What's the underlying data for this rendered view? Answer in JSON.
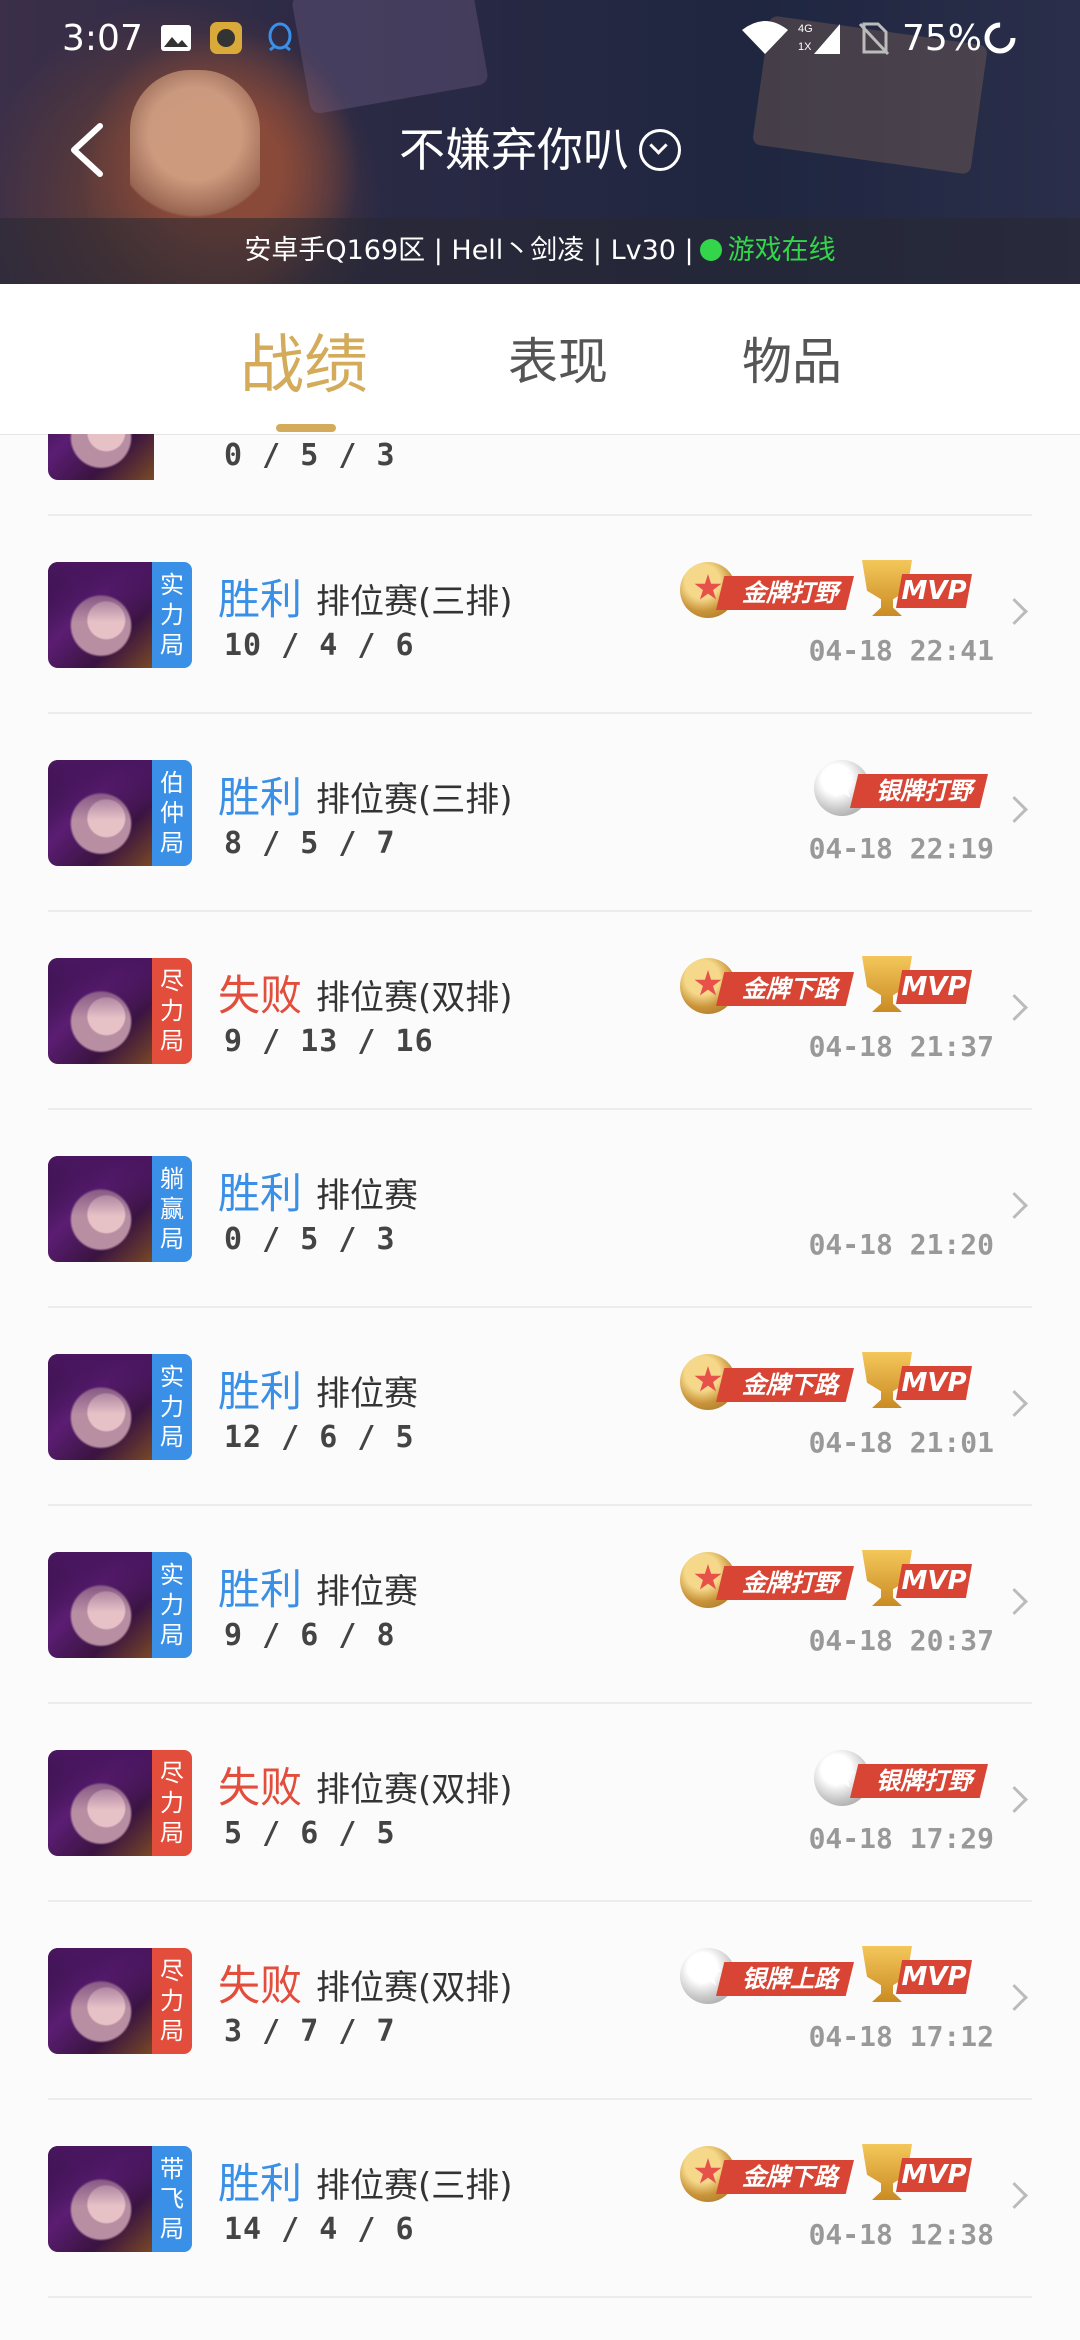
{
  "status": {
    "time": "3:07",
    "battery": "75%",
    "network": "4G 1X"
  },
  "header": {
    "title": "不嫌弃你叭",
    "info_prefix": "安卓手Q169区 | Hell丶剑凌 | Lv30 |",
    "online": "游戏在线"
  },
  "tabs": [
    {
      "label": "战绩",
      "active": true
    },
    {
      "label": "表现",
      "active": false
    },
    {
      "label": "物品",
      "active": false
    }
  ],
  "colors": {
    "accent": "#d3ab5b",
    "win": "#3a90e6",
    "lose": "#e34d3c",
    "online": "#33d64a"
  },
  "partial_row": {
    "kda": "0 / 5 / 3"
  },
  "matches": [
    {
      "tag": [
        "实",
        "力",
        "局"
      ],
      "tag_color": "blue",
      "result": "胜利",
      "outcome": "win",
      "mode": "排位赛(三排)",
      "kda": "10 / 4 / 6",
      "date": "04-18 22:41",
      "badge": {
        "type": "gold",
        "label": "金牌打野"
      },
      "mvp": "MVP"
    },
    {
      "tag": [
        "伯",
        "仲",
        "局"
      ],
      "tag_color": "blue",
      "result": "胜利",
      "outcome": "win",
      "mode": "排位赛(三排)",
      "kda": "8 / 5 / 7",
      "date": "04-18 22:19",
      "badge": {
        "type": "silver",
        "label": "银牌打野"
      },
      "mvp": null
    },
    {
      "tag": [
        "尽",
        "力",
        "局"
      ],
      "tag_color": "red",
      "result": "失败",
      "outcome": "lose",
      "mode": "排位赛(双排)",
      "kda": "9 / 13 / 16",
      "date": "04-18 21:37",
      "badge": {
        "type": "gold",
        "label": "金牌下路"
      },
      "mvp": "MVP"
    },
    {
      "tag": [
        "躺",
        "赢",
        "局"
      ],
      "tag_color": "blue",
      "result": "胜利",
      "outcome": "win",
      "mode": "排位赛",
      "kda": "0 / 5 / 3",
      "date": "04-18 21:20",
      "badge": null,
      "mvp": null
    },
    {
      "tag": [
        "实",
        "力",
        "局"
      ],
      "tag_color": "blue",
      "result": "胜利",
      "outcome": "win",
      "mode": "排位赛",
      "kda": "12 / 6 / 5",
      "date": "04-18 21:01",
      "badge": {
        "type": "gold",
        "label": "金牌下路"
      },
      "mvp": "MVP"
    },
    {
      "tag": [
        "实",
        "力",
        "局"
      ],
      "tag_color": "blue",
      "result": "胜利",
      "outcome": "win",
      "mode": "排位赛",
      "kda": "9 / 6 / 8",
      "date": "04-18 20:37",
      "badge": {
        "type": "gold",
        "label": "金牌打野"
      },
      "mvp": "MVP"
    },
    {
      "tag": [
        "尽",
        "力",
        "局"
      ],
      "tag_color": "red",
      "result": "失败",
      "outcome": "lose",
      "mode": "排位赛(双排)",
      "kda": "5 / 6 / 5",
      "date": "04-18 17:29",
      "badge": {
        "type": "silver",
        "label": "银牌打野"
      },
      "mvp": null
    },
    {
      "tag": [
        "尽",
        "力",
        "局"
      ],
      "tag_color": "red",
      "result": "失败",
      "outcome": "lose",
      "mode": "排位赛(双排)",
      "kda": "3 / 7 / 7",
      "date": "04-18 17:12",
      "badge": {
        "type": "silver",
        "label": "银牌上路"
      },
      "mvp": "MVP"
    },
    {
      "tag": [
        "带",
        "飞",
        "局"
      ],
      "tag_color": "blue",
      "result": "胜利",
      "outcome": "win",
      "mode": "排位赛(三排)",
      "kda": "14 / 4 / 6",
      "date": "04-18 12:38",
      "badge": {
        "type": "gold",
        "label": "金牌下路"
      },
      "mvp": "MVP"
    }
  ]
}
